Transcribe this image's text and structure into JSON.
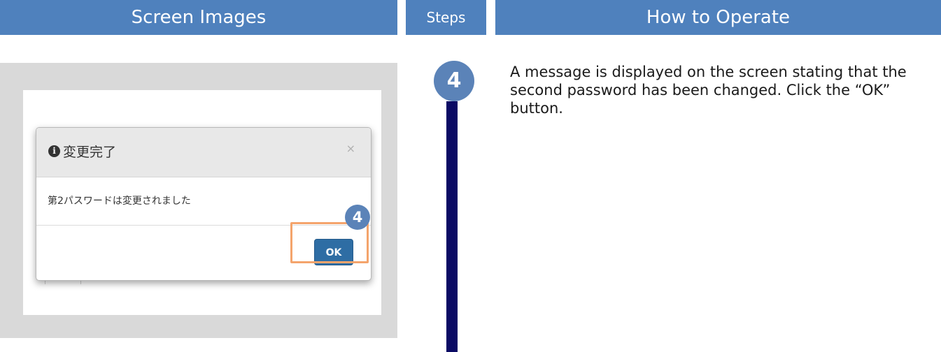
{
  "headers": {
    "screen_images": "Screen Images",
    "steps": "Steps",
    "how_to_operate": "How to Operate"
  },
  "dialog": {
    "title": "変更完了",
    "close_symbol": "×",
    "message": "第2パスワードは変更されました",
    "ok_label": "OK",
    "info_icon_glyph": "i"
  },
  "callout": {
    "step_number": "4",
    "highlight_color": "#f4a46c"
  },
  "step": {
    "number": "4",
    "line_color": "#0a0a64",
    "badge_color": "#5b83b8"
  },
  "instruction": {
    "text": "A message is displayed on the screen stating that the second password has been changed. Click the “OK” button."
  },
  "theme": {
    "header_color": "#4f81bd",
    "screen_bg_color": "#d9d9d9",
    "button_color": "#2e6da4"
  }
}
